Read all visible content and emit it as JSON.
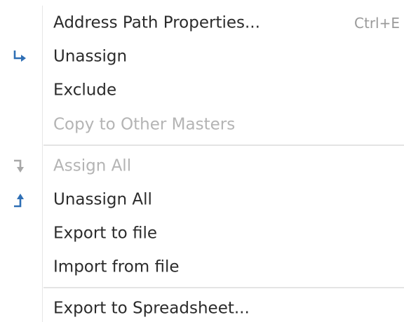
{
  "menu": {
    "items": [
      {
        "label": "Address Path Properties...",
        "shortcut": "Ctrl+E",
        "enabled": true,
        "icon": null
      },
      {
        "label": "Unassign",
        "enabled": true,
        "icon": "unassign-arrow-icon",
        "icon_color": "#2f6fb5"
      },
      {
        "label": "Exclude",
        "enabled": true,
        "icon": null
      },
      {
        "label": "Copy to Other Masters",
        "enabled": false,
        "icon": null
      },
      {
        "label": "Assign All",
        "enabled": false,
        "icon": "assign-all-arrow-icon",
        "icon_color": "#a8a8a8"
      },
      {
        "label": "Unassign All",
        "enabled": true,
        "icon": "unassign-all-arrow-icon",
        "icon_color": "#2f6fb5"
      },
      {
        "label": "Export to file",
        "enabled": true,
        "icon": null
      },
      {
        "label": "Import from file",
        "enabled": true,
        "icon": null
      },
      {
        "label": "Export to Spreadsheet...",
        "enabled": true,
        "icon": null
      }
    ]
  },
  "colors": {
    "text": "#2b2b2b",
    "disabled_text": "#b4b4b4",
    "shortcut_text": "#9a9a9a",
    "separator": "#e4e4e4",
    "icon_blue": "#2f6fb5"
  }
}
